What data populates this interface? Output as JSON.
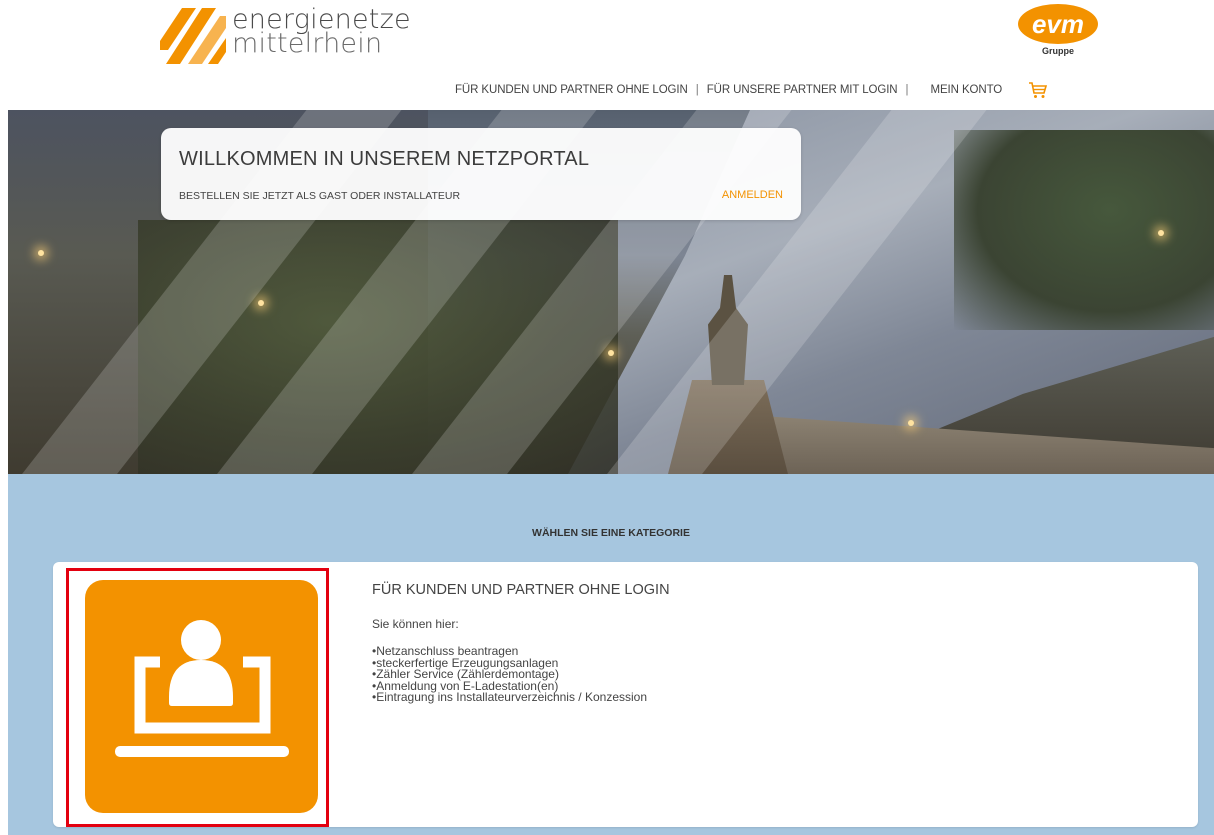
{
  "header": {
    "logo": {
      "line1": "energienetze",
      "line2": "mittelrhein",
      "icon": "logo-stripes-icon"
    },
    "group_logo": {
      "text": "evm",
      "sub": "Gruppe"
    },
    "nav": [
      {
        "label": "FÜR KUNDEN UND PARTNER OHNE LOGIN"
      },
      {
        "label": "FÜR UNSERE PARTNER MIT LOGIN"
      }
    ],
    "separator": "|",
    "account_label": "MEIN KONTO",
    "cart_icon": "cart-icon"
  },
  "hero": {
    "title": "WILLKOMMEN IN UNSEREM NETZPORTAL",
    "subtitle": "BESTELLEN SIE JETZT ALS GAST ODER INSTALLATEUR",
    "login_label": "ANMELDEN"
  },
  "categories": {
    "heading": "WÄHLEN SIE EINE KATEGORIE",
    "items": [
      {
        "title": "FÜR KUNDEN UND PARTNER OHNE LOGIN",
        "intro": "Sie können hier:",
        "icon": "user-laptop-icon",
        "bullets": [
          "Netzanschluss beantragen",
          "steckerfertige Erzeugungsanlagen",
          "Zähler Service (Zählerdemontage)",
          "Anmeldung von E-Ladestation(en)",
          "Eintragung ins Installateurverzeichnis / Konzession"
        ]
      }
    ]
  },
  "colors": {
    "accent": "#f39200",
    "section_bg": "#a6c6df",
    "highlight_border": "#e3000f"
  }
}
